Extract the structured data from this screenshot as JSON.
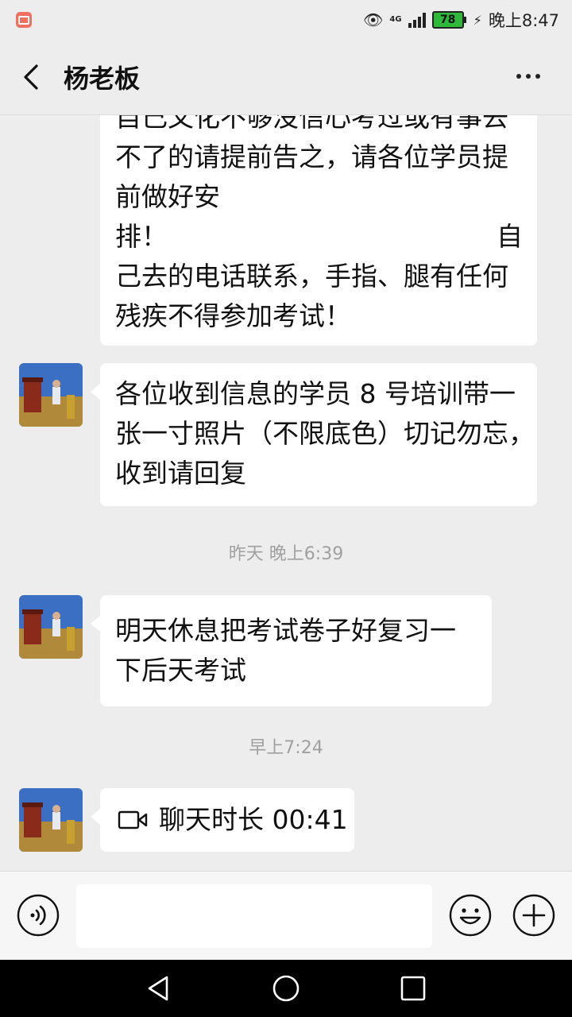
{
  "status_bar": {
    "network": "4G",
    "battery": "78",
    "time": "晚上8:47"
  },
  "header": {
    "title": "杨老板"
  },
  "messages": [
    {
      "lines": [
        "自己文化不够没信心考过或有事去",
        "不了的请提前告之，请各位学员提",
        "前做好安",
        "排！",
        "自",
        "己去的电话联系，手指、腿有任何",
        "残疾不得参加考试！"
      ]
    },
    {
      "lines": [
        "各位收到信息的学员 8 号培训带一",
        "张一寸照片（不限底色）切记勿忘，",
        "收到请回复"
      ]
    },
    {
      "timestamp": "昨天 晚上6:39"
    },
    {
      "lines": [
        "明天休息把考试卷子好复习一",
        "下后天考试"
      ]
    },
    {
      "timestamp": "早上7:24"
    },
    {
      "call_text": "聊天时长 00:41"
    }
  ],
  "input": {
    "value": ""
  },
  "colors": {
    "background": "#ededed",
    "bubble": "#ffffff",
    "timestamp": "#a0a0a0",
    "battery": "#2fb83a"
  }
}
